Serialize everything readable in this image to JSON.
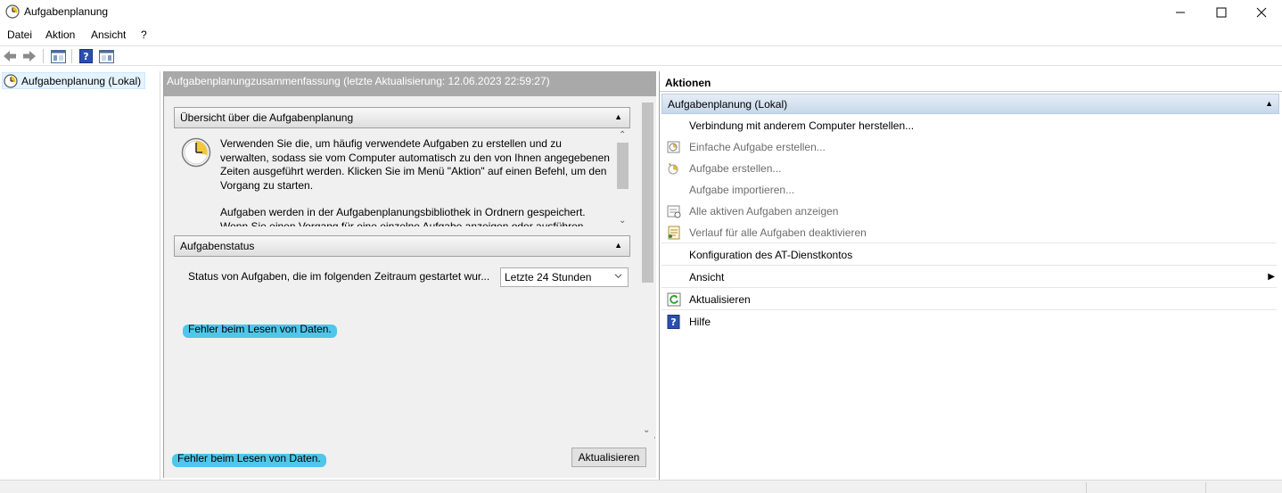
{
  "window": {
    "title": "Aufgabenplanung",
    "icons": [
      "clock-icon",
      "minimize-icon",
      "maximize-icon",
      "close-icon"
    ]
  },
  "menu": [
    "Datei",
    "Aktion",
    "Ansicht",
    "?"
  ],
  "toolbar": {
    "icons": [
      "back-arrow-icon",
      "forward-arrow-icon",
      "show-hide-console-tree-icon",
      "help-icon",
      "show-hide-action-pane-icon"
    ]
  },
  "tree": {
    "root_label": "Aufgabenplanung (Lokal)"
  },
  "center": {
    "header": "Aufgabenplanungzusammenfassung (letzte Aktualisierung: 12.06.2023 22:59:27)",
    "overview": {
      "title": "Übersicht über die Aufgabenplanung",
      "paragraph1": "Verwenden Sie die, um häufig verwendete Aufgaben zu erstellen und zu verwalten, sodass sie vom Computer automatisch zu den von Ihnen angegebenen Zeiten ausgeführt werden. Klicken Sie im Menü \"Aktion\" auf einen Befehl, um den Vorgang zu starten.",
      "paragraph2": "Aufgaben werden in der Aufgabenplanungsbibliothek in Ordnern gespeichert. Wenn Sie einen Vorgang für eine einzelne Aufgabe anzeigen oder ausführen"
    },
    "status": {
      "title": "Aufgabenstatus",
      "period_label": "Status von Aufgaben, die im folgenden Zeitraum gestartet wur...",
      "period_value": "Letzte 24 Stunden",
      "error": "Fehler beim Lesen von Daten."
    },
    "footer": {
      "error": "Fehler beim Lesen von Daten.",
      "refresh_label": "Aktualisieren"
    }
  },
  "actions": {
    "title": "Aktionen",
    "group": "Aufgabenplanung (Lokal)",
    "items": [
      {
        "label": "Verbindung mit anderem Computer herstellen...",
        "enabled": true,
        "icon": ""
      },
      {
        "label": "Einfache Aufgabe erstellen...",
        "enabled": false,
        "icon": "create-basic-task-icon"
      },
      {
        "label": "Aufgabe erstellen...",
        "enabled": false,
        "icon": "create-task-icon"
      },
      {
        "label": "Aufgabe importieren...",
        "enabled": false,
        "icon": ""
      },
      {
        "label": "Alle aktiven Aufgaben anzeigen",
        "enabled": false,
        "icon": "running-tasks-icon"
      },
      {
        "label": "Verlauf für alle Aufgaben deaktivieren",
        "enabled": false,
        "icon": "history-icon"
      },
      {
        "label": "Konfiguration des AT-Dienstkontos",
        "enabled": true,
        "icon": ""
      },
      {
        "label": "Ansicht",
        "enabled": true,
        "icon": "",
        "submenu": true
      },
      {
        "label": "Aktualisieren",
        "enabled": true,
        "icon": "refresh-icon"
      },
      {
        "label": "Hilfe",
        "enabled": true,
        "icon": "help-icon"
      }
    ]
  }
}
